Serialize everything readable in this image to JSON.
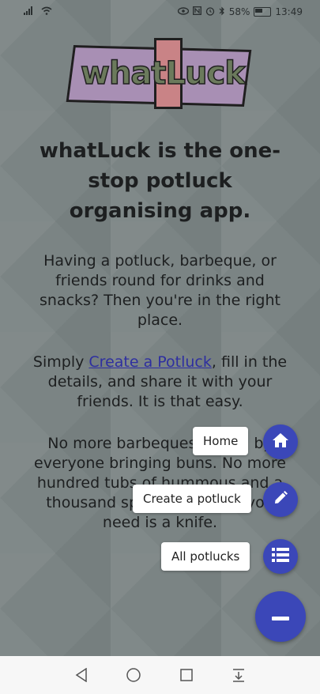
{
  "status_bar": {
    "battery": "58%",
    "time": "13:49"
  },
  "logo": {
    "text": "whatLuck"
  },
  "headline": "whatLuck is the one-stop potluck organising app.",
  "intro": "Having a potluck, barbeque, or friends round for drinks and snacks? Then you're in the right place.",
  "instructions": {
    "before": "Simply ",
    "link": "Create a Potluck",
    "after": ", fill in the details, and share it with your friends. It is that easy."
  },
  "tagline": "No more barbeques ruined by everyone bringing buns. No more hundred tubs of hummous and a thousand spoons when all you need is a knife.",
  "fab_menu": {
    "items": [
      {
        "label": "Home",
        "icon": "home-icon"
      },
      {
        "label": "Create a potluck",
        "icon": "pencil-icon"
      },
      {
        "label": "All potlucks",
        "icon": "list-icon"
      }
    ],
    "main_icon": "minus-icon"
  },
  "colors": {
    "accent": "#3b47b8",
    "link": "#2e2fa0",
    "background": "#7b8484"
  },
  "nav_bar": {
    "icons": [
      "back-icon",
      "home-circle-icon",
      "recents-icon",
      "notification-drawer-icon"
    ]
  }
}
